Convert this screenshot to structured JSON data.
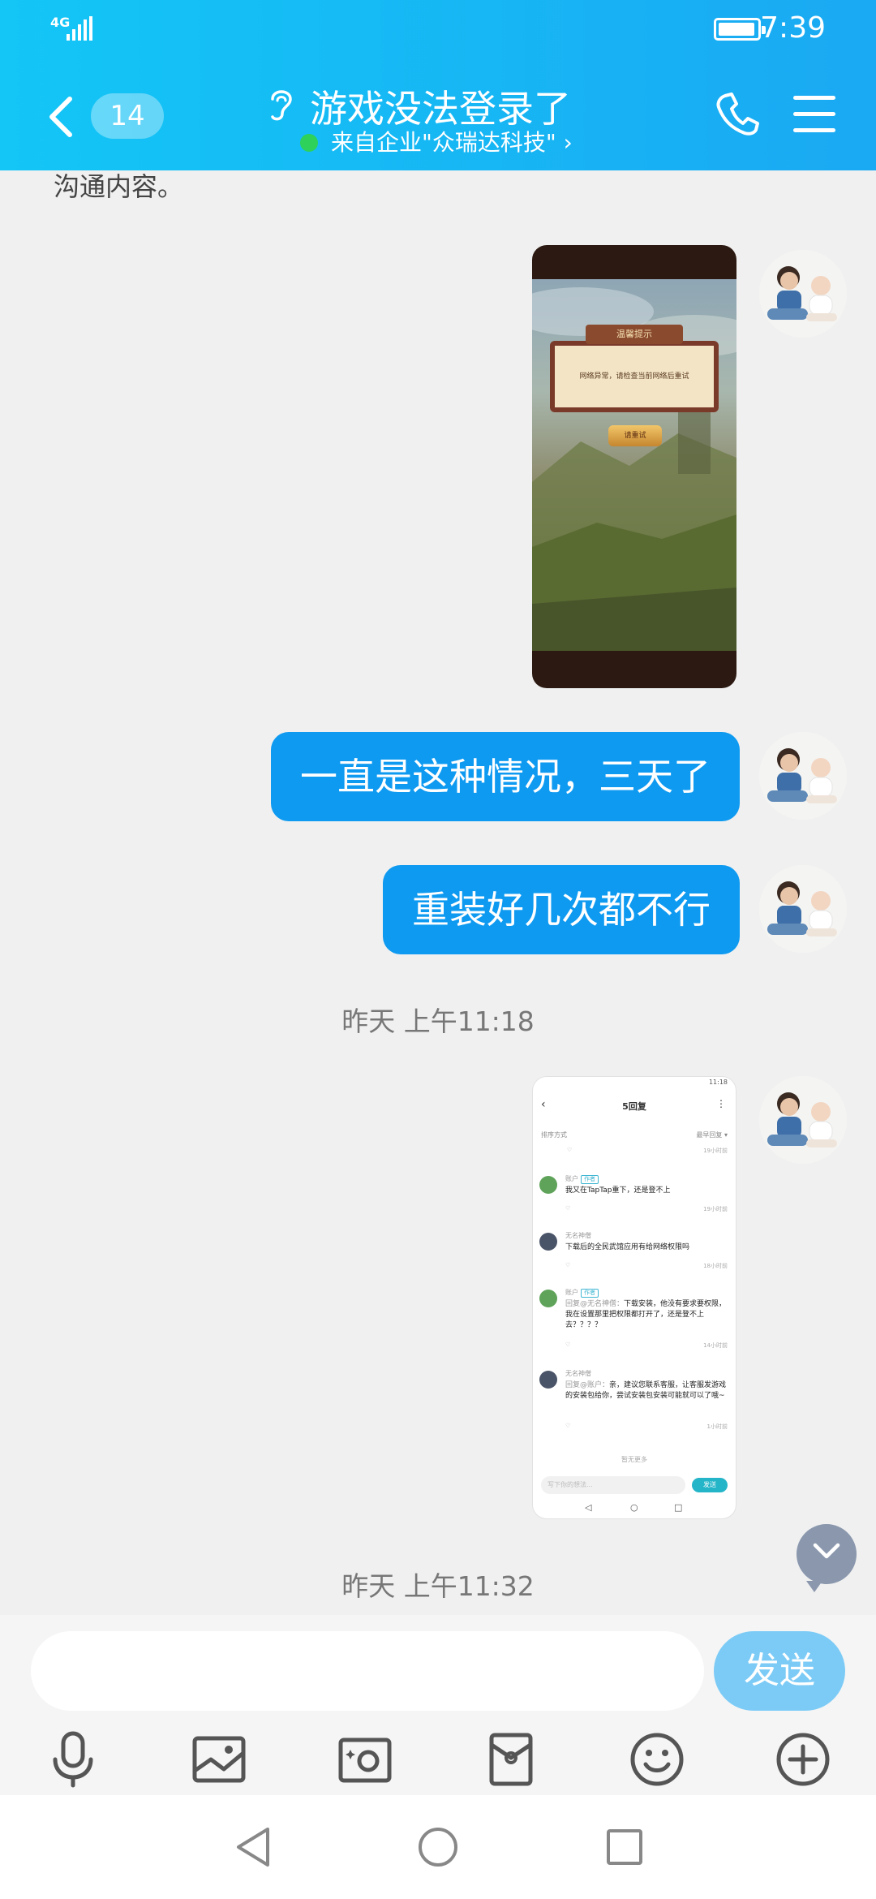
{
  "status_bar": {
    "network": "4G",
    "time": "7:39"
  },
  "header": {
    "unread_count": "14",
    "title": "游戏没法登录了",
    "subtitle": "来自企业\"众瑞达科技\" ›"
  },
  "chat": {
    "partial_text": "沟通内容。",
    "game_screenshot": {
      "dialog_title": "温馨提示",
      "dialog_message": "网络异常，请检查当前网络后重试",
      "button_label": "请重试"
    },
    "messages": [
      {
        "text": "一直是这种情况，三天了"
      },
      {
        "text": "重装好几次都不行"
      }
    ],
    "timestamps": [
      "昨天 上午11:18",
      "昨天 上午11:32"
    ],
    "forum_screenshot": {
      "status_time": "11:18",
      "title": "5回复",
      "sort_label": "排序方式",
      "sort_value": "最早回复 ▾",
      "first_meta": "19小时前",
      "comments": [
        {
          "name": "账户",
          "tag": "作者",
          "text": "我又在TapTap重下，还是登不上",
          "time": "19小时前"
        },
        {
          "name": "无名神僧",
          "tag": "",
          "text": "下载后的全民武馆应用有给网络权限吗",
          "time": "18小时前"
        },
        {
          "name": "账户",
          "tag": "作者",
          "reply_prefix": "回复@无名神僧：",
          "text": "下载安装，他没有要求要权限，我在设置那里把权限都打开了，还是登不上去？？？？",
          "time": "14小时前"
        },
        {
          "name": "无名神僧",
          "tag": "",
          "reply_prefix": "回复@账户：",
          "text": "亲，建议您联系客服，让客服发游戏的安装包给你，尝试安装包安装可能就可以了哦~",
          "time": "1小时前"
        }
      ],
      "more": "暂无更多",
      "input_placeholder": "写下你的想法...",
      "send": "发送"
    }
  },
  "input_bar": {
    "placeholder": "",
    "send_label": "发送"
  },
  "tool_icons": [
    "microphone-icon",
    "image-icon",
    "camera-icon",
    "red-packet-icon",
    "emoji-icon",
    "plus-icon"
  ],
  "colors": {
    "header_start": "#13c6f6",
    "header_end": "#1aa9f3",
    "bubble": "#0e9af1",
    "send_button": "#7ccbf6"
  }
}
